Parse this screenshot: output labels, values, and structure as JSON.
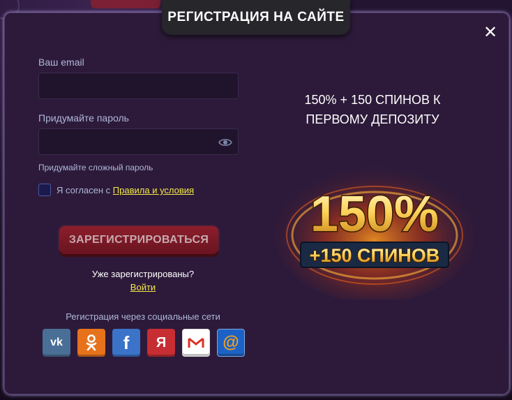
{
  "modal": {
    "title": "РЕГИСТРАЦИЯ НА САЙТЕ",
    "close": "✕"
  },
  "form": {
    "email_label": "Ваш email",
    "email_value": "",
    "password_label": "Придумайте пароль",
    "password_value": "",
    "password_hint": "Придумайте сложный пароль",
    "agree_text": "Я согласен с",
    "agree_link": "Правила и условия",
    "agree_checked": false,
    "register_label": "ЗАРЕГИСТРИРОВАТЬСЯ",
    "already_text": "Уже зарегистрированы?",
    "login_link": "Войти"
  },
  "social": {
    "title": "Регистрация через социальные сети",
    "buttons": [
      {
        "name": "vk",
        "glyph": "vk",
        "color": "#4a6f96"
      },
      {
        "name": "odnoklassniki",
        "glyph": "ok",
        "color": "#e6731c"
      },
      {
        "name": "facebook",
        "glyph": "f",
        "color": "#3b73c8"
      },
      {
        "name": "yandex",
        "glyph": "Я",
        "color": "#c62e33"
      },
      {
        "name": "gmail",
        "glyph": "M",
        "color": "#ffffff"
      },
      {
        "name": "mailru",
        "glyph": "@",
        "color": "#1c62c6"
      }
    ]
  },
  "promo": {
    "text": "150% + 150 СПИНОВ К ПЕРВОМУ ДЕПОЗИТУ",
    "image_big": "150%",
    "image_small": "+150 СПИНОВ"
  },
  "colors": {
    "accent_link": "#f4e94a",
    "register_bg": "#8c1e2c",
    "modal_bg": "#2d1a3a"
  }
}
